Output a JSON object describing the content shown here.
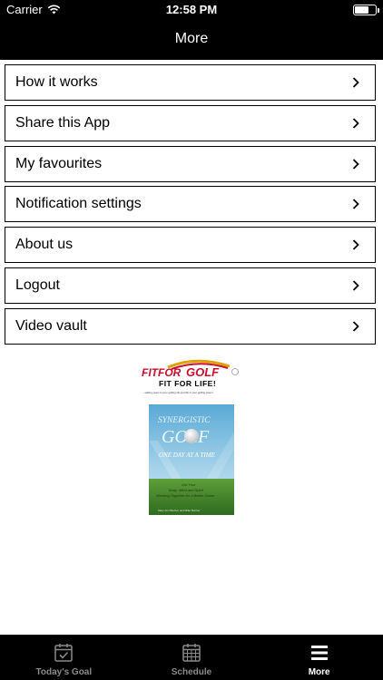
{
  "status": {
    "carrier": "Carrier",
    "time": "12:58 PM"
  },
  "nav": {
    "title": "More"
  },
  "menu": [
    {
      "label": "How it works"
    },
    {
      "label": "Share this App"
    },
    {
      "label": "My favourites"
    },
    {
      "label": "Notification settings"
    },
    {
      "label": "About us"
    },
    {
      "label": "Logout"
    },
    {
      "label": "Video vault"
    }
  ],
  "logo": {
    "brand_left": "FITFOR",
    "brand_right": "GOLF",
    "tagline": "FIT FOR LIFE!",
    "subline": "...adding years to your golfing life and life to your golfing years!"
  },
  "book": {
    "title_1": "SYNERGISTIC",
    "title_2": "GOLF",
    "subtitle": "ONE DAY AT A TIME",
    "blurb_1": "Get Your",
    "blurb_2": "Body, Mind and Spirit",
    "blurb_3": "Working Together for a Better Game",
    "authors": "Mary Ann Bucher and Mike Bucher"
  },
  "tabs": [
    {
      "label": "Today's Goal",
      "icon": "calendar-check-icon",
      "active": false
    },
    {
      "label": "Schedule",
      "icon": "calendar-grid-icon",
      "active": false
    },
    {
      "label": "More",
      "icon": "hamburger-menu-icon",
      "active": true
    }
  ],
  "colors": {
    "bar": "#000000",
    "tab_active": "#ffffff",
    "tab_inactive": "#8a8a8a",
    "logo_red": "#c8102e"
  }
}
